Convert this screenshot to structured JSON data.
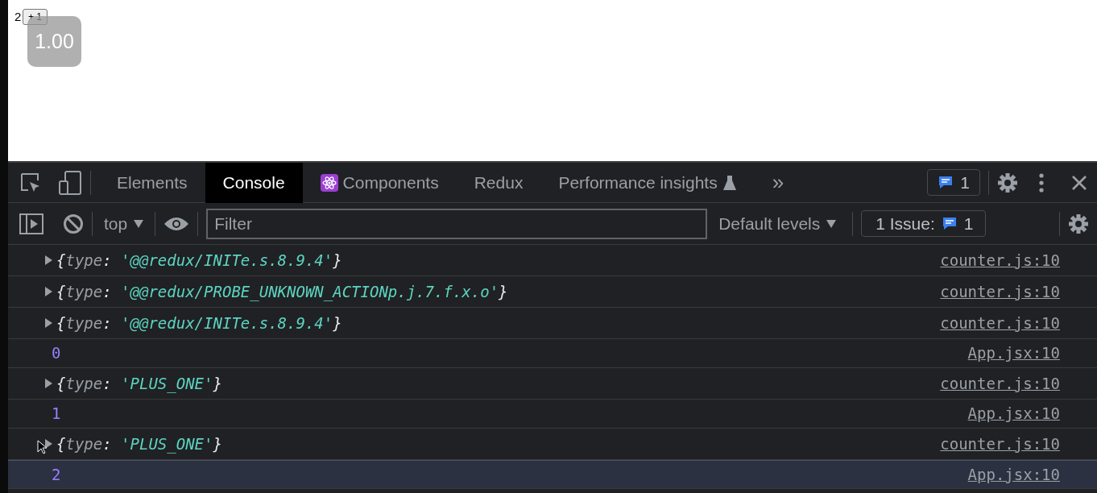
{
  "page": {
    "counter": "2",
    "button": "+ 1",
    "overlay": "1.00"
  },
  "devtools": {
    "tabs": [
      {
        "label": "Elements",
        "selected": false,
        "kind": "plain"
      },
      {
        "label": "Console",
        "selected": true,
        "kind": "plain"
      },
      {
        "label": "Components",
        "selected": false,
        "kind": "react"
      },
      {
        "label": "Redux",
        "selected": false,
        "kind": "plain"
      },
      {
        "label": "Performance insights",
        "selected": false,
        "kind": "experimental"
      }
    ],
    "more": "»",
    "messages_badge": "1"
  },
  "console_toolbar": {
    "context": "top",
    "filter_placeholder": "Filter",
    "levels": "Default levels",
    "issues_label": "1 Issue:",
    "issues_count": "1"
  },
  "messages": [
    {
      "kind": "object",
      "prefix": "{",
      "key": "type",
      "separator": ":",
      "value": "'@@redux/INITe.s.8.9.4'",
      "suffix": "}",
      "source": "counter.js:10",
      "selected": false
    },
    {
      "kind": "object",
      "prefix": "{",
      "key": "type",
      "separator": ":",
      "value": "'@@redux/PROBE_UNKNOWN_ACTIONp.j.7.f.x.o'",
      "suffix": "}",
      "source": "counter.js:10",
      "selected": false
    },
    {
      "kind": "object",
      "prefix": "{",
      "key": "type",
      "separator": ":",
      "value": "'@@redux/INITe.s.8.9.4'",
      "suffix": "}",
      "source": "counter.js:10",
      "selected": false
    },
    {
      "kind": "number",
      "value": "0",
      "source": "App.jsx:10",
      "selected": false
    },
    {
      "kind": "object",
      "prefix": "{",
      "key": "type",
      "separator": ":",
      "value": "'PLUS_ONE'",
      "suffix": "}",
      "source": "counter.js:10",
      "selected": false
    },
    {
      "kind": "number",
      "value": "1",
      "source": "App.jsx:10",
      "selected": false
    },
    {
      "kind": "object",
      "prefix": "{",
      "key": "type",
      "separator": ":",
      "value": "'PLUS_ONE'",
      "suffix": "}",
      "source": "counter.js:10",
      "selected": false
    },
    {
      "kind": "number",
      "value": "2",
      "source": "App.jsx:10",
      "selected": true
    }
  ]
}
